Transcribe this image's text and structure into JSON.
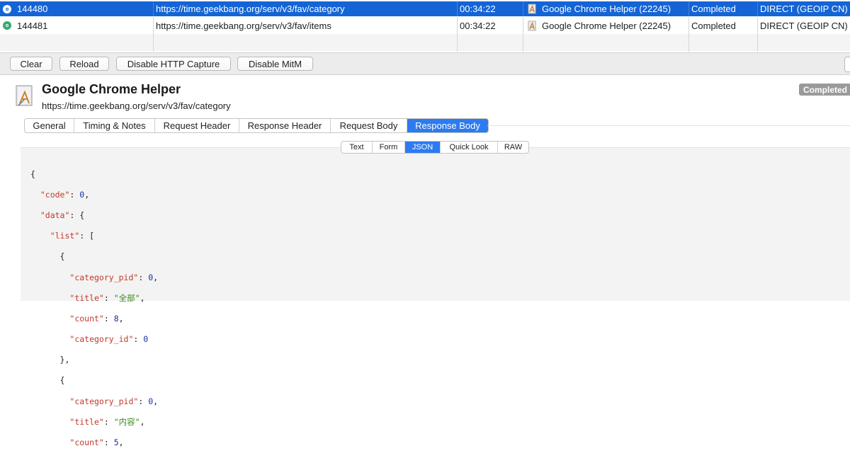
{
  "requests": [
    {
      "id": "144480",
      "url": "https://time.geekbang.org/serv/v3/fav/category",
      "time": "00:34:22",
      "client": "Google Chrome Helper (22245)",
      "status": "Completed",
      "rule": "DIRECT (GEOIP CN)",
      "selected": true
    },
    {
      "id": "144481",
      "url": "https://time.geekbang.org/serv/v3/fav/items",
      "time": "00:34:22",
      "client": "Google Chrome Helper (22245)",
      "status": "Completed",
      "rule": "DIRECT (GEOIP CN)",
      "selected": false
    }
  ],
  "toolbar": {
    "clear": "Clear",
    "reload": "Reload",
    "disable_http_capture": "Disable HTTP Capture",
    "disable_mitm": "Disable MitM"
  },
  "detail": {
    "app_name": "Google Chrome Helper",
    "url": "https://time.geekbang.org/serv/v3/fav/category",
    "status_badge": "Completed",
    "tabs": [
      "General",
      "Timing & Notes",
      "Request Header",
      "Response Header",
      "Request Body",
      "Response Body"
    ],
    "active_tab": "Response Body",
    "view_modes": [
      "Text",
      "Form",
      "JSON",
      "Quick Look",
      "RAW"
    ],
    "active_view_mode": "JSON"
  },
  "json_body": {
    "l01": "{",
    "k02": "\"code\"",
    "v02": "0",
    "k03": "\"data\"",
    "k04": "\"list\"",
    "l05": "{",
    "k06": "\"category_pid\"",
    "v06": "0",
    "k07": "\"title\"",
    "v07": "\"全部\"",
    "k08": "\"count\"",
    "v08": "8",
    "k09": "\"category_id\"",
    "v09": "0",
    "l10": "},",
    "l11": "{",
    "k12": "\"category_pid\"",
    "v12": "0",
    "k13": "\"title\"",
    "v13": "\"内容\"",
    "k14": "\"count\"",
    "v14": "5"
  },
  "colors": {
    "selection": "#1464d6",
    "active_tab": "#2c7bf0",
    "status_ok": "#39a872",
    "json_key": "#c0392b",
    "json_number": "#1a2ea8",
    "json_string": "#3c8a1c"
  }
}
